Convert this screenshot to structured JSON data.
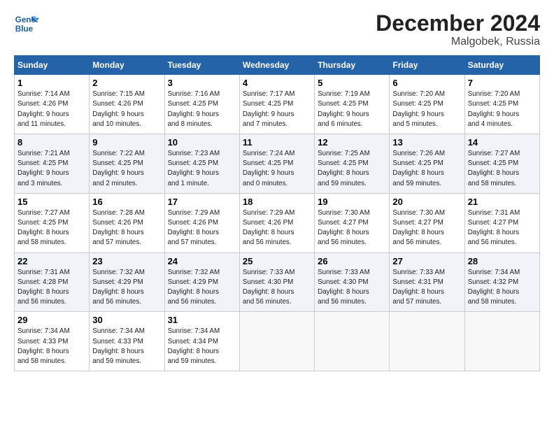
{
  "header": {
    "logo_line1": "General",
    "logo_line2": "Blue",
    "title": "December 2024",
    "subtitle": "Malgobek, Russia"
  },
  "days_of_week": [
    "Sunday",
    "Monday",
    "Tuesday",
    "Wednesday",
    "Thursday",
    "Friday",
    "Saturday"
  ],
  "weeks": [
    [
      {
        "day": "1",
        "info": "Sunrise: 7:14 AM\nSunset: 4:26 PM\nDaylight: 9 hours\nand 11 minutes."
      },
      {
        "day": "2",
        "info": "Sunrise: 7:15 AM\nSunset: 4:26 PM\nDaylight: 9 hours\nand 10 minutes."
      },
      {
        "day": "3",
        "info": "Sunrise: 7:16 AM\nSunset: 4:25 PM\nDaylight: 9 hours\nand 8 minutes."
      },
      {
        "day": "4",
        "info": "Sunrise: 7:17 AM\nSunset: 4:25 PM\nDaylight: 9 hours\nand 7 minutes."
      },
      {
        "day": "5",
        "info": "Sunrise: 7:19 AM\nSunset: 4:25 PM\nDaylight: 9 hours\nand 6 minutes."
      },
      {
        "day": "6",
        "info": "Sunrise: 7:20 AM\nSunset: 4:25 PM\nDaylight: 9 hours\nand 5 minutes."
      },
      {
        "day": "7",
        "info": "Sunrise: 7:20 AM\nSunset: 4:25 PM\nDaylight: 9 hours\nand 4 minutes."
      }
    ],
    [
      {
        "day": "8",
        "info": "Sunrise: 7:21 AM\nSunset: 4:25 PM\nDaylight: 9 hours\nand 3 minutes."
      },
      {
        "day": "9",
        "info": "Sunrise: 7:22 AM\nSunset: 4:25 PM\nDaylight: 9 hours\nand 2 minutes."
      },
      {
        "day": "10",
        "info": "Sunrise: 7:23 AM\nSunset: 4:25 PM\nDaylight: 9 hours\nand 1 minute."
      },
      {
        "day": "11",
        "info": "Sunrise: 7:24 AM\nSunset: 4:25 PM\nDaylight: 9 hours\nand 0 minutes."
      },
      {
        "day": "12",
        "info": "Sunrise: 7:25 AM\nSunset: 4:25 PM\nDaylight: 8 hours\nand 59 minutes."
      },
      {
        "day": "13",
        "info": "Sunrise: 7:26 AM\nSunset: 4:25 PM\nDaylight: 8 hours\nand 59 minutes."
      },
      {
        "day": "14",
        "info": "Sunrise: 7:27 AM\nSunset: 4:25 PM\nDaylight: 8 hours\nand 58 minutes."
      }
    ],
    [
      {
        "day": "15",
        "info": "Sunrise: 7:27 AM\nSunset: 4:25 PM\nDaylight: 8 hours\nand 58 minutes."
      },
      {
        "day": "16",
        "info": "Sunrise: 7:28 AM\nSunset: 4:26 PM\nDaylight: 8 hours\nand 57 minutes."
      },
      {
        "day": "17",
        "info": "Sunrise: 7:29 AM\nSunset: 4:26 PM\nDaylight: 8 hours\nand 57 minutes."
      },
      {
        "day": "18",
        "info": "Sunrise: 7:29 AM\nSunset: 4:26 PM\nDaylight: 8 hours\nand 56 minutes."
      },
      {
        "day": "19",
        "info": "Sunrise: 7:30 AM\nSunset: 4:27 PM\nDaylight: 8 hours\nand 56 minutes."
      },
      {
        "day": "20",
        "info": "Sunrise: 7:30 AM\nSunset: 4:27 PM\nDaylight: 8 hours\nand 56 minutes."
      },
      {
        "day": "21",
        "info": "Sunrise: 7:31 AM\nSunset: 4:27 PM\nDaylight: 8 hours\nand 56 minutes."
      }
    ],
    [
      {
        "day": "22",
        "info": "Sunrise: 7:31 AM\nSunset: 4:28 PM\nDaylight: 8 hours\nand 56 minutes."
      },
      {
        "day": "23",
        "info": "Sunrise: 7:32 AM\nSunset: 4:29 PM\nDaylight: 8 hours\nand 56 minutes."
      },
      {
        "day": "24",
        "info": "Sunrise: 7:32 AM\nSunset: 4:29 PM\nDaylight: 8 hours\nand 56 minutes."
      },
      {
        "day": "25",
        "info": "Sunrise: 7:33 AM\nSunset: 4:30 PM\nDaylight: 8 hours\nand 56 minutes."
      },
      {
        "day": "26",
        "info": "Sunrise: 7:33 AM\nSunset: 4:30 PM\nDaylight: 8 hours\nand 56 minutes."
      },
      {
        "day": "27",
        "info": "Sunrise: 7:33 AM\nSunset: 4:31 PM\nDaylight: 8 hours\nand 57 minutes."
      },
      {
        "day": "28",
        "info": "Sunrise: 7:34 AM\nSunset: 4:32 PM\nDaylight: 8 hours\nand 58 minutes."
      }
    ],
    [
      {
        "day": "29",
        "info": "Sunrise: 7:34 AM\nSunset: 4:33 PM\nDaylight: 8 hours\nand 58 minutes."
      },
      {
        "day": "30",
        "info": "Sunrise: 7:34 AM\nSunset: 4:33 PM\nDaylight: 8 hours\nand 59 minutes."
      },
      {
        "day": "31",
        "info": "Sunrise: 7:34 AM\nSunset: 4:34 PM\nDaylight: 8 hours\nand 59 minutes."
      },
      null,
      null,
      null,
      null
    ]
  ]
}
